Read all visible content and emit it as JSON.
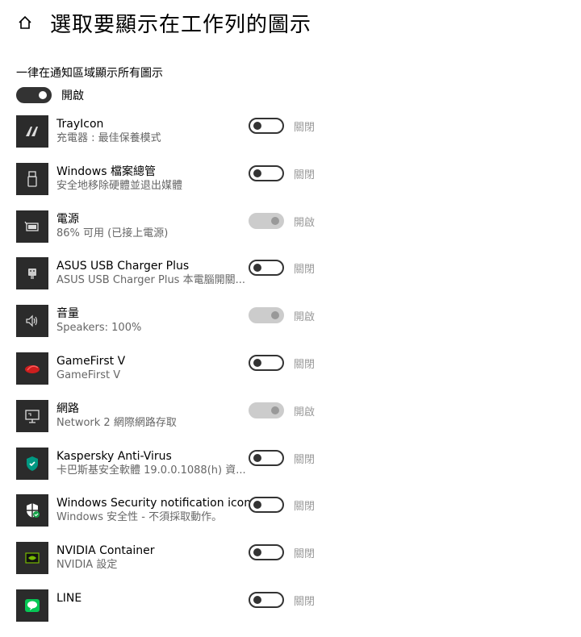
{
  "header": {
    "title": "選取要顯示在工作列的圖示",
    "home_icon": "home-icon"
  },
  "master": {
    "label": "一律在通知區域顯示所有圖示",
    "state": "開啟",
    "on": true
  },
  "items": [
    {
      "name": "TrayIcon",
      "sub": "充電器 : 最佳保養模式",
      "state": "關閉",
      "on": false,
      "disabled": false,
      "icon": "trayicon-icon"
    },
    {
      "name": "Windows 檔案總管",
      "sub": "安全地移除硬體並退出媒體",
      "state": "關閉",
      "on": false,
      "disabled": false,
      "icon": "usb-drive-icon"
    },
    {
      "name": "電源",
      "sub": "86% 可用 (已接上電源)",
      "state": "開啟",
      "on": true,
      "disabled": true,
      "icon": "battery-icon"
    },
    {
      "name": "ASUS USB Charger Plus",
      "sub": "ASUS USB Charger Plus 本電腦開關...",
      "state": "關閉",
      "on": false,
      "disabled": false,
      "icon": "usb-charger-icon"
    },
    {
      "name": "音量",
      "sub": "Speakers: 100%",
      "state": "開啟",
      "on": true,
      "disabled": true,
      "icon": "speaker-icon"
    },
    {
      "name": "GameFirst V",
      "sub": "GameFirst V",
      "state": "關閉",
      "on": false,
      "disabled": false,
      "icon": "gamefirst-icon"
    },
    {
      "name": "網路",
      "sub": "Network 2 網際網路存取",
      "state": "開啟",
      "on": true,
      "disabled": true,
      "icon": "network-icon"
    },
    {
      "name": "Kaspersky Anti-Virus",
      "sub": "卡巴斯基安全軟體 19.0.0.1088(h) 資...",
      "state": "關閉",
      "on": false,
      "disabled": false,
      "icon": "kaspersky-icon"
    },
    {
      "name": "Windows Security notification icon",
      "sub": "Windows 安全性 - 不須採取動作。",
      "state": "關閉",
      "on": false,
      "disabled": false,
      "icon": "shield-icon"
    },
    {
      "name": "NVIDIA Container",
      "sub": "NVIDIA 設定",
      "state": "關閉",
      "on": false,
      "disabled": false,
      "icon": "nvidia-icon"
    },
    {
      "name": "LINE",
      "sub": "",
      "state": "關閉",
      "on": false,
      "disabled": false,
      "icon": "line-icon"
    }
  ]
}
